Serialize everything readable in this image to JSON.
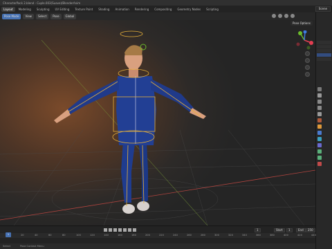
{
  "window": {
    "title": "CharacterPack 2.blend - Cuple.003(Suave)/BlenderAnim"
  },
  "workspaces": [
    "Layout",
    "Modeling",
    "Sculpting",
    "UV Editing",
    "Texture Paint",
    "Shading",
    "Animation",
    "Rendering",
    "Compositing",
    "Geometry Nodes",
    "Scripting"
  ],
  "active_workspace": "Layout",
  "scene": {
    "label": "Scene"
  },
  "viewport": {
    "mode_label": "Pose Mode",
    "view_menus": [
      "View",
      "Select",
      "Pose"
    ],
    "transform_orientation": "Global",
    "pose_options_label": "Pose Options"
  },
  "timeline": {
    "current_frame": "1",
    "start_label": "Start",
    "start_value": "1",
    "end_label": "End",
    "end_value": "250",
    "ruler_ticks": [
      "1",
      "20",
      "40",
      "60",
      "80",
      "100",
      "120",
      "140",
      "160",
      "180",
      "200",
      "220",
      "240",
      "260",
      "280",
      "300",
      "320",
      "340",
      "360",
      "380",
      "400",
      "420",
      "440"
    ]
  },
  "status": {
    "left": "Select",
    "mid": "Pose Context Menu"
  },
  "colors": {
    "accent": "#4772b3",
    "suit": "#1f3c8f",
    "armature": "#e7b13a",
    "gizmo_x": "#e33e51",
    "gizmo_y": "#6bbb2b",
    "gizmo_z": "#3d7be0"
  }
}
